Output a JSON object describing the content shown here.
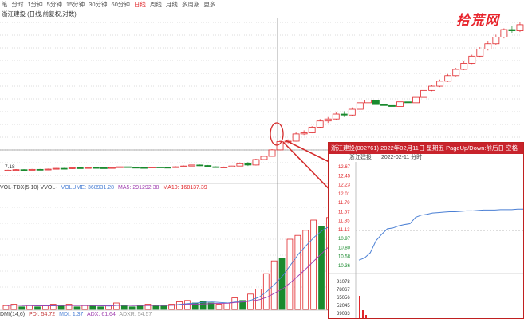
{
  "toolbar": {
    "items": [
      "笔",
      "分时",
      "1分钟",
      "5分钟",
      "15分钟",
      "30分钟",
      "60分钟",
      "日线",
      "周线",
      "月线",
      "多周期",
      "更多"
    ],
    "active_index": 7
  },
  "stock_title": "浙江建投 (日线,前复权,对数)",
  "brand": "拾荒网",
  "price_low_label": "7.18",
  "volume_legend": {
    "name": "VOL-TDX(5,10) VVOL-",
    "volume": "VOLUME: 368931.28",
    "ma5": "MA5: 291292.38",
    "ma10": "MA10: 168137.39"
  },
  "dmi_legend": {
    "name": "DMI(14,6)",
    "pdi": "PDI: 54.72",
    "mdi": "MDI: 1.37",
    "adx": "ADX: 61.64",
    "adxr": "ADXR: 54.57"
  },
  "popup": {
    "header": "浙江建投(002761) 2022年02月11日 星期五 PageUp/Down:前后日 空格",
    "sub_name": "浙江建投",
    "sub_date": "2022-02-11 分时",
    "price_ticks": [
      "12.67",
      "12.45",
      "12.23",
      "12.01",
      "11.79",
      "11.57",
      "11.35",
      "11.13",
      "10.97",
      "10.80",
      "10.58",
      "10.36"
    ],
    "vol_ticks": [
      "91078",
      "78067",
      "65056",
      "52045",
      "39033"
    ],
    "price_low": 10.36,
    "price_high": 12.67,
    "intraday": [
      10.45,
      10.5,
      10.62,
      10.9,
      11.05,
      11.18,
      11.2,
      11.25,
      11.28,
      11.3,
      11.45,
      11.5,
      11.52,
      11.55,
      11.56,
      11.57,
      11.58,
      11.58,
      11.59,
      11.6,
      11.6,
      11.61,
      11.62,
      11.62,
      11.62,
      11.63,
      11.63,
      11.63,
      11.64,
      11.64
    ]
  },
  "colors": {
    "up": "#e0262a",
    "down": "#1a8a2e",
    "ma_blue": "#4a7fd4",
    "ma_purple": "#a040b0",
    "arrow": "#d42a2a"
  },
  "candles": [
    [
      7.18,
      7.2,
      7.16,
      7.22
    ],
    [
      7.2,
      7.22,
      7.18,
      7.24
    ],
    [
      7.22,
      7.21,
      7.2,
      7.24
    ],
    [
      7.21,
      7.23,
      7.2,
      7.25
    ],
    [
      7.23,
      7.22,
      7.21,
      7.25
    ],
    [
      7.22,
      7.24,
      7.2,
      7.26
    ],
    [
      7.24,
      7.27,
      7.23,
      7.28
    ],
    [
      7.27,
      7.26,
      7.25,
      7.29
    ],
    [
      7.26,
      7.29,
      7.25,
      7.3
    ],
    [
      7.29,
      7.27,
      7.26,
      7.3
    ],
    [
      7.27,
      7.3,
      7.26,
      7.31
    ],
    [
      7.3,
      7.29,
      7.28,
      7.32
    ],
    [
      7.29,
      7.28,
      7.27,
      7.31
    ],
    [
      7.28,
      7.3,
      7.27,
      7.32
    ],
    [
      7.3,
      7.33,
      7.29,
      7.34
    ],
    [
      7.33,
      7.31,
      7.3,
      7.35
    ],
    [
      7.31,
      7.3,
      7.29,
      7.33
    ],
    [
      7.3,
      7.29,
      7.28,
      7.32
    ],
    [
      7.29,
      7.32,
      7.28,
      7.33
    ],
    [
      7.32,
      7.31,
      7.3,
      7.34
    ],
    [
      7.31,
      7.3,
      7.29,
      7.33
    ],
    [
      7.3,
      7.33,
      7.29,
      7.35
    ],
    [
      7.33,
      7.36,
      7.32,
      7.38
    ],
    [
      7.36,
      7.4,
      7.35,
      7.41
    ],
    [
      7.4,
      7.38,
      7.36,
      7.42
    ],
    [
      7.38,
      7.33,
      7.31,
      7.4
    ],
    [
      7.33,
      7.31,
      7.3,
      7.35
    ],
    [
      7.31,
      7.32,
      7.3,
      7.34
    ],
    [
      7.32,
      7.36,
      7.31,
      7.37
    ],
    [
      7.36,
      7.45,
      7.35,
      7.5
    ],
    [
      7.45,
      7.4,
      7.36,
      7.52
    ],
    [
      7.4,
      7.62,
      7.38,
      7.65
    ],
    [
      7.62,
      7.75,
      7.6,
      7.78
    ],
    [
      7.75,
      8.02,
      7.74,
      8.05
    ],
    [
      8.02,
      8.38,
      8.0,
      8.45
    ],
    [
      8.38,
      8.4,
      8.3,
      8.48
    ],
    [
      8.4,
      8.73,
      8.38,
      8.8
    ],
    [
      8.73,
      8.78,
      8.68,
      8.9
    ],
    [
      8.78,
      9.05,
      8.76,
      9.1
    ],
    [
      9.05,
      9.35,
      9.02,
      9.45
    ],
    [
      9.35,
      9.45,
      9.25,
      9.55
    ],
    [
      9.45,
      9.7,
      9.4,
      9.8
    ],
    [
      9.7,
      9.65,
      9.55,
      9.85
    ],
    [
      9.65,
      9.95,
      9.6,
      10.05
    ],
    [
      9.95,
      10.3,
      9.9,
      10.4
    ],
    [
      10.3,
      10.45,
      10.2,
      10.55
    ],
    [
      10.45,
      10.2,
      10.1,
      10.55
    ],
    [
      10.2,
      10.15,
      10.05,
      10.3
    ],
    [
      10.15,
      10.1,
      10.0,
      10.25
    ],
    [
      10.1,
      10.35,
      10.05,
      10.45
    ],
    [
      10.35,
      10.3,
      10.2,
      10.45
    ],
    [
      10.3,
      10.6,
      10.25,
      10.7
    ],
    [
      10.6,
      11.0,
      10.55,
      11.1
    ],
    [
      11.0,
      11.25,
      10.95,
      11.35
    ],
    [
      11.25,
      11.55,
      11.2,
      11.65
    ],
    [
      11.55,
      11.9,
      11.5,
      12.0
    ],
    [
      11.9,
      12.3,
      11.85,
      12.4
    ],
    [
      12.3,
      12.7,
      12.25,
      12.85
    ],
    [
      12.7,
      13.2,
      12.65,
      13.3
    ],
    [
      13.2,
      13.7,
      13.1,
      13.85
    ],
    [
      13.7,
      14.1,
      13.6,
      14.3
    ],
    [
      14.1,
      14.6,
      14.0,
      14.8
    ],
    [
      14.6,
      15.2,
      14.5,
      15.3
    ],
    [
      15.2,
      15.1,
      14.9,
      15.5
    ],
    [
      15.1,
      15.6,
      15.0,
      15.8
    ]
  ],
  "volumes": [
    [
      3,
      1
    ],
    [
      4,
      1
    ],
    [
      2,
      0
    ],
    [
      3,
      1
    ],
    [
      2,
      0
    ],
    [
      3,
      1
    ],
    [
      4,
      1
    ],
    [
      3,
      0
    ],
    [
      4,
      1
    ],
    [
      2,
      0
    ],
    [
      3,
      1
    ],
    [
      3,
      0
    ],
    [
      2,
      0
    ],
    [
      3,
      1
    ],
    [
      5,
      1
    ],
    [
      3,
      0
    ],
    [
      2,
      0
    ],
    [
      3,
      0
    ],
    [
      4,
      1
    ],
    [
      3,
      0
    ],
    [
      3,
      0
    ],
    [
      4,
      1
    ],
    [
      6,
      1
    ],
    [
      7,
      1
    ],
    [
      5,
      0
    ],
    [
      6,
      0
    ],
    [
      5,
      0
    ],
    [
      4,
      1
    ],
    [
      5,
      1
    ],
    [
      9,
      1
    ],
    [
      7,
      0
    ],
    [
      12,
      1
    ],
    [
      16,
      1
    ],
    [
      28,
      1
    ],
    [
      38,
      1
    ],
    [
      40,
      0
    ],
    [
      55,
      1
    ],
    [
      58,
      1
    ],
    [
      62,
      1
    ],
    [
      70,
      1
    ],
    [
      65,
      0
    ],
    [
      72,
      1
    ],
    [
      62,
      0
    ],
    [
      68,
      1
    ],
    [
      80,
      1
    ]
  ]
}
